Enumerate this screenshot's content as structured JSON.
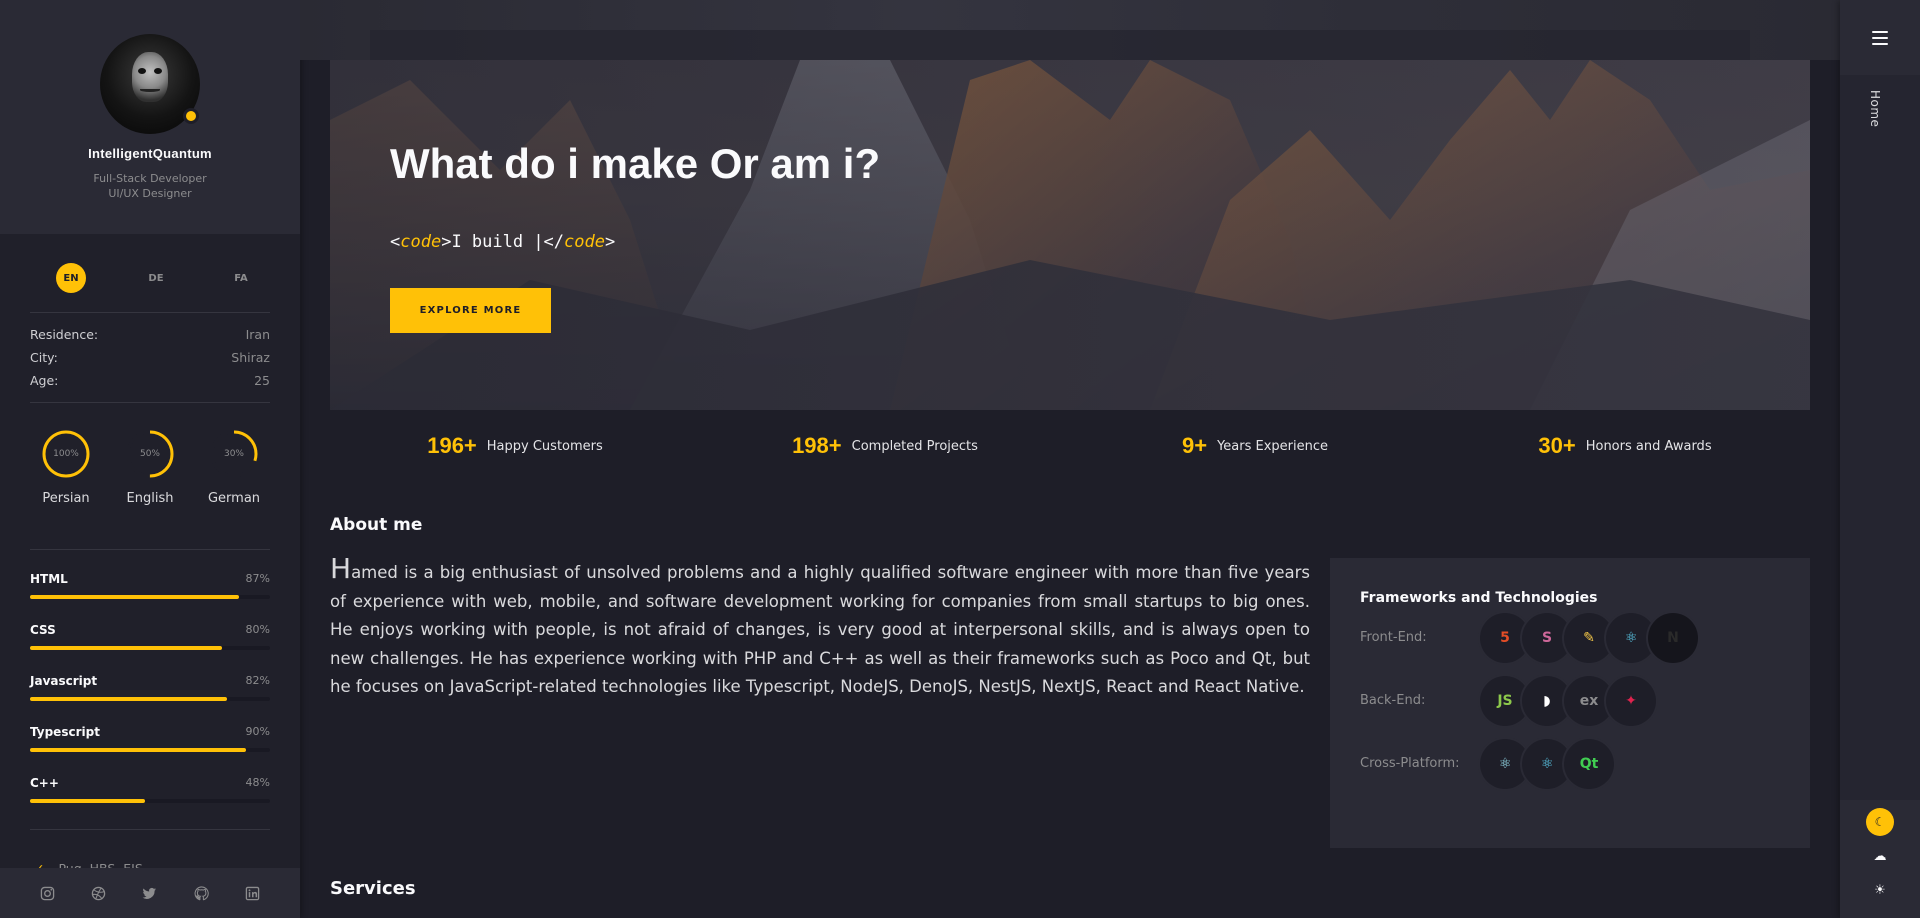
{
  "profile": {
    "name": "IntelligentQuantum",
    "role_line1": "Full-Stack Developer",
    "role_line2": "UI/UX Designer"
  },
  "languages_switch": [
    {
      "label": "EN",
      "active": true
    },
    {
      "label": "DE",
      "active": false
    },
    {
      "label": "FA",
      "active": false
    }
  ],
  "info": [
    {
      "key": "Residence:",
      "value": "Iran"
    },
    {
      "key": "City:",
      "value": "Shiraz"
    },
    {
      "key": "Age:",
      "value": "25"
    }
  ],
  "spoken_languages": [
    {
      "label": "Persian",
      "value_text": "100%",
      "value": 100
    },
    {
      "label": "English",
      "value_text": "50%",
      "value": 50
    },
    {
      "label": "German",
      "value_text": "30%",
      "value": 30
    }
  ],
  "skills": [
    {
      "name": "HTML",
      "pct_text": "87%",
      "pct": 87
    },
    {
      "name": "CSS",
      "pct_text": "80%",
      "pct": 80
    },
    {
      "name": "Javascript",
      "pct_text": "82%",
      "pct": 82
    },
    {
      "name": "Typescript",
      "pct_text": "90%",
      "pct": 90
    },
    {
      "name": "C++",
      "pct_text": "48%",
      "pct": 48
    }
  ],
  "libraries": [
    "Pug, HBS, EJS"
  ],
  "social_icons": [
    "instagram-icon",
    "dribbble-icon",
    "twitter-icon",
    "github-icon",
    "linkedin-icon"
  ],
  "rail": {
    "nav_label": "Home",
    "themes": [
      "moon-icon",
      "cloud-icon",
      "sun-icon"
    ]
  },
  "hero": {
    "title": "What do i make Or am i?",
    "code_open_bracket": "<",
    "code_tag": "code",
    "code_text": ">I build |</",
    "code_close_bracket": ">",
    "button_label": "EXPLORE MORE"
  },
  "stats": [
    {
      "num": "196+",
      "label": "Happy Customers"
    },
    {
      "num": "198+",
      "label": "Completed Projects"
    },
    {
      "num": "9+",
      "label": "Years Experience"
    },
    {
      "num": "30+",
      "label": "Honors and Awards"
    }
  ],
  "about": {
    "heading": "About me",
    "text": "Hamed is a big enthusiast of unsolved problems and a highly qualified software engineer with more than five years of experience with web, mobile, and software development working for companies from small startups to big ones. He enjoys working with people, is not afraid of changes, is very good at interpersonal skills, and is always open to new challenges. He has experience working with PHP and C++ as well as their frameworks such as Poco and Qt, but he focuses on JavaScript-related technologies like Typescript, NodeJS, DenoJS, NestJS, NextJS, React and React Native."
  },
  "tech": {
    "title": "Frameworks and Technologies",
    "rows": [
      {
        "label": "Front-End:",
        "icons": [
          {
            "name": "html5-icon",
            "glyph": "5",
            "color": "#e44d26"
          },
          {
            "name": "sass-icon",
            "glyph": "S",
            "color": "#cd6799"
          },
          {
            "name": "gulp-icon",
            "glyph": "✎",
            "color": "#f7c948"
          },
          {
            "name": "react-icon",
            "glyph": "⚛",
            "color": "#61dafb"
          },
          {
            "name": "nextjs-icon",
            "glyph": "N",
            "color": "#111111"
          }
        ]
      },
      {
        "label": "Back-End:",
        "icons": [
          {
            "name": "nodejs-icon",
            "glyph": "JS",
            "color": "#8cc84b"
          },
          {
            "name": "deno-icon",
            "glyph": "◗",
            "color": "#ffffff"
          },
          {
            "name": "express-icon",
            "glyph": "ex",
            "color": "#8c8c8e"
          },
          {
            "name": "nestjs-icon",
            "glyph": "✦",
            "color": "#e0234e"
          }
        ]
      },
      {
        "label": "Cross-Platform:",
        "icons": [
          {
            "name": "electron-icon",
            "glyph": "⚛",
            "color": "#9feaf9"
          },
          {
            "name": "react-native-icon",
            "glyph": "⚛",
            "color": "#61dafb"
          },
          {
            "name": "qt-icon",
            "glyph": "Qt",
            "color": "#41cd52"
          }
        ]
      }
    ]
  },
  "services": {
    "heading": "Services"
  },
  "colors": {
    "accent": "#ffc107",
    "bg": "#1e1e28",
    "panel": "#2a2a35"
  }
}
